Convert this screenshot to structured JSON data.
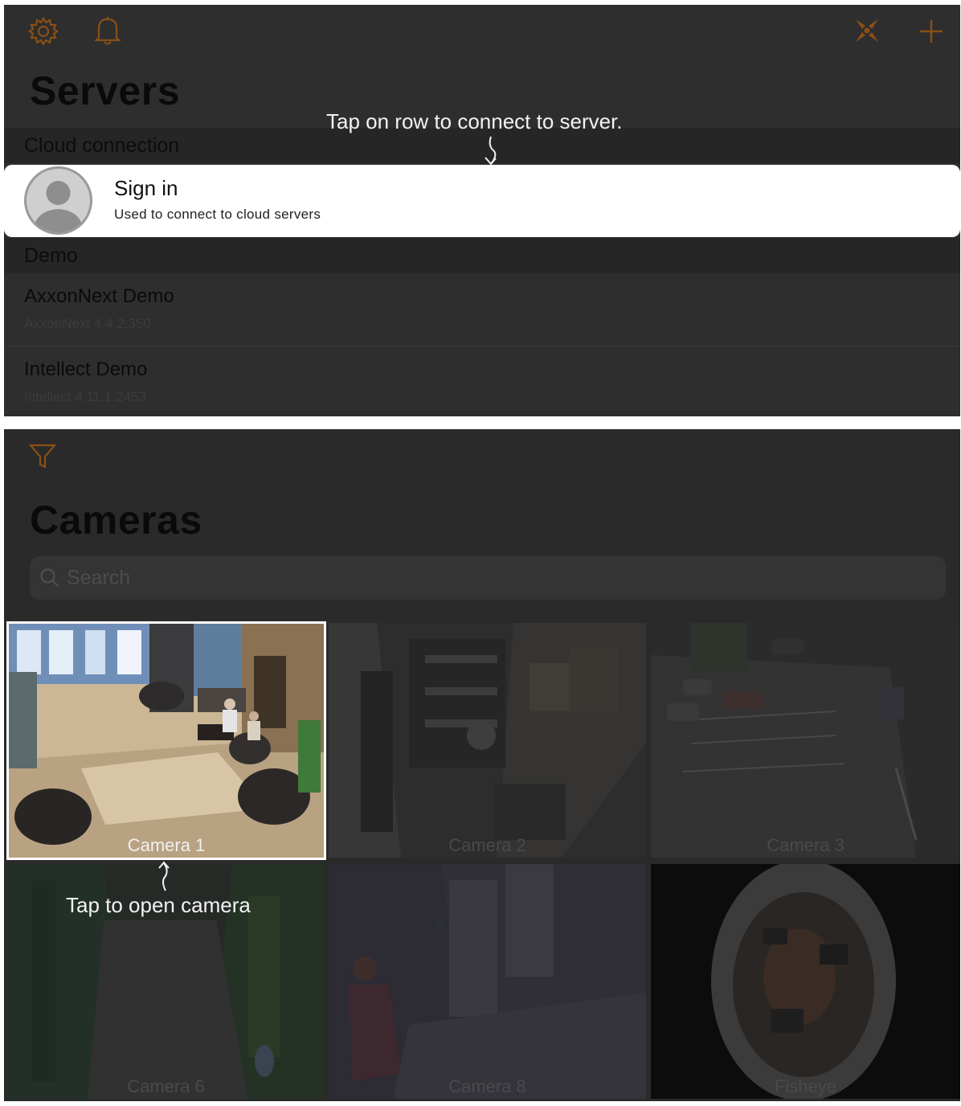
{
  "servers": {
    "title": "Servers",
    "hint": "Tap on row to connect to server.",
    "colors": {
      "accent": "#8a4f16",
      "panel_bg": "#2e2e2e"
    },
    "icons": {
      "settings": "gear-icon",
      "notifications": "bell-icon",
      "connect": "network-icon",
      "add": "plus-icon"
    },
    "cloud_section": {
      "header": "Cloud connection",
      "row": {
        "title": "Sign in",
        "subtitle": "Used to connect to cloud servers"
      }
    },
    "demo_section": {
      "header": "Demo",
      "items": [
        {
          "name": "AxxonNext Demo",
          "version": "AxxonNext 4.4.2.350"
        },
        {
          "name": "Intellect Demo",
          "version": "Intellect 4.11.1.2453"
        }
      ]
    }
  },
  "cameras": {
    "title": "Cameras",
    "search_placeholder": "Search",
    "hint": "Tap to open camera",
    "icons": {
      "filter": "filter-icon",
      "search": "search-icon"
    },
    "tiles": [
      {
        "label": "Camera 1"
      },
      {
        "label": "Camera 2"
      },
      {
        "label": "Camera 3"
      },
      {
        "label": "Camera 6"
      },
      {
        "label": "Camera 8"
      },
      {
        "label": "Fisheye"
      }
    ]
  }
}
